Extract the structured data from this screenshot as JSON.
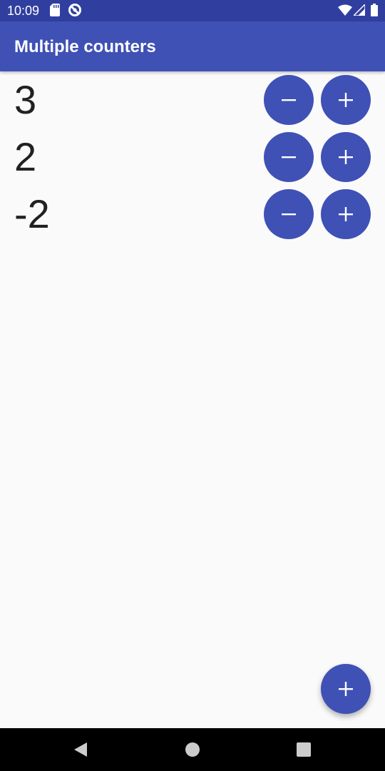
{
  "status_bar": {
    "time": "10:09",
    "left_icons": [
      "sd-card-icon",
      "no-signal-icon"
    ],
    "right_icons": [
      "wifi-icon",
      "cell-signal-icon",
      "battery-icon"
    ]
  },
  "app_bar": {
    "title": "Multiple counters"
  },
  "counters": [
    {
      "value": "3",
      "decrement_icon": "minus-icon",
      "increment_icon": "plus-icon"
    },
    {
      "value": "2",
      "decrement_icon": "minus-icon",
      "increment_icon": "plus-icon"
    },
    {
      "value": "-2",
      "decrement_icon": "minus-icon",
      "increment_icon": "plus-icon"
    }
  ],
  "fab": {
    "icon": "plus-icon"
  },
  "nav_bar": {
    "buttons": [
      "back-icon",
      "home-icon",
      "recents-icon"
    ]
  },
  "colors": {
    "primary": "#3f51b5",
    "primary_dark": "#303f9f",
    "background": "#fafafa",
    "text": "#212121"
  }
}
